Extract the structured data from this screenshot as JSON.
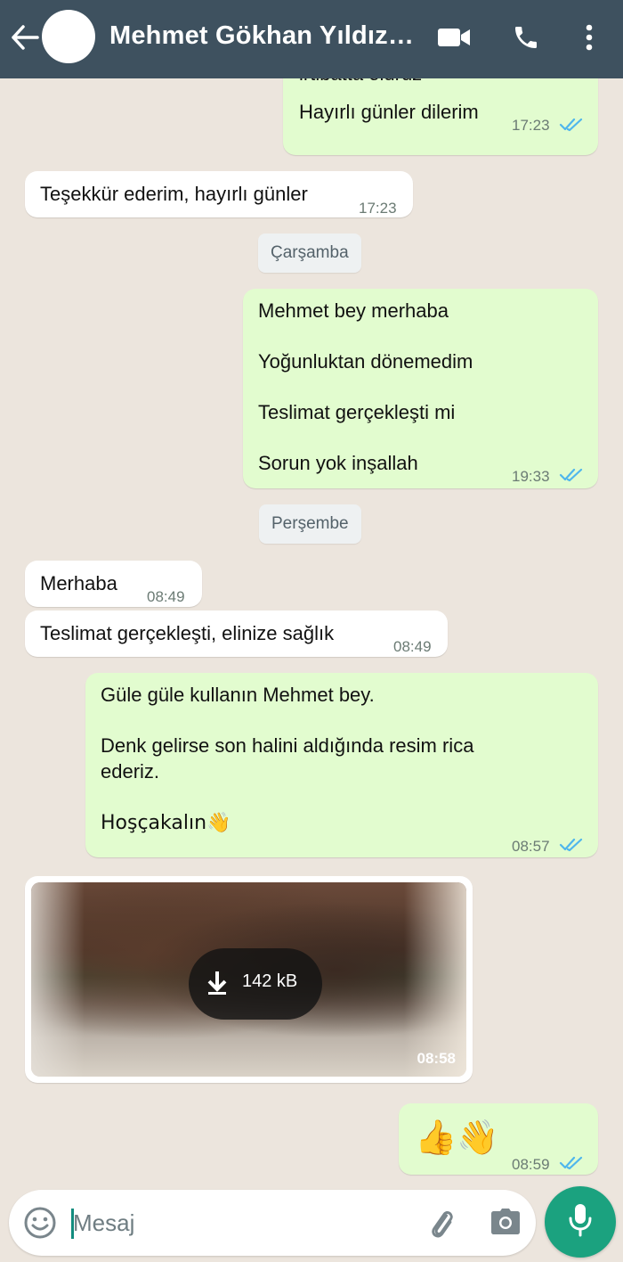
{
  "header": {
    "contact_name": "Mehmet Gökhan Yıldız…",
    "background": "#3e515f"
  },
  "messages": {
    "m1": {
      "partial_top": "irtibatta oluruz",
      "text": "Hayırlı günler dilerim",
      "time": "17:23",
      "direction": "out",
      "status": "read"
    },
    "m2": {
      "text": "Teşekkür ederim, hayırlı günler",
      "time": "17:23",
      "direction": "in"
    },
    "date1": "Çarşamba",
    "m3": {
      "lines": [
        "Mehmet bey merhaba",
        "Yoğunluktan dönemedim",
        "Teslimat gerçekleşti mi",
        "Sorun yok inşallah"
      ],
      "time": "19:33",
      "direction": "out",
      "status": "read"
    },
    "date2": "Perşembe",
    "m4": {
      "text": "Merhaba",
      "time": "08:49",
      "direction": "in"
    },
    "m5": {
      "text": "Teslimat gerçekleşti, elinize sağlık",
      "time": "08:49",
      "direction": "in"
    },
    "m6": {
      "lines": [
        "Güle güle kullanın Mehmet bey.",
        "Denk gelirse son halini aldığında resim rica",
        "ederiz.",
        "Hoşçakalın👋"
      ],
      "time": "08:57",
      "direction": "out",
      "status": "read"
    },
    "m7": {
      "type": "image",
      "download_size": "142 kB",
      "time": "08:58",
      "direction": "in"
    },
    "m8": {
      "text": "👍👋",
      "time": "08:59",
      "direction": "out",
      "status": "read"
    }
  },
  "composer": {
    "placeholder": "Mesaj",
    "icons": [
      "emoji-icon",
      "paperclip-icon",
      "camera-icon",
      "microphone-icon"
    ],
    "mic_color": "#1ba27f"
  },
  "colors": {
    "outgoing_bubble": "#e2fccf",
    "incoming_bubble": "#ffffff",
    "read_ticks": "#4fb6ec",
    "chat_background": "#ece5dd"
  }
}
